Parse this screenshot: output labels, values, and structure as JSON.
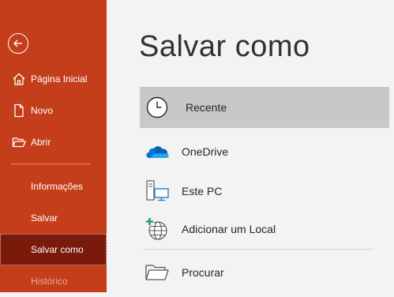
{
  "sidebar": {
    "back_icon": "back-arrow-icon",
    "items": [
      {
        "label": "Página Inicial",
        "icon": "home-icon"
      },
      {
        "label": "Novo",
        "icon": "new-document-icon"
      },
      {
        "label": "Abrir",
        "icon": "open-folder-icon"
      },
      {
        "label": "Informações"
      },
      {
        "label": "Salvar"
      },
      {
        "label": "Salvar como",
        "selected": true
      },
      {
        "label": "Histórico",
        "muted": true
      }
    ],
    "colors": {
      "background": "#c43e1c",
      "selected": "#7a1a0a"
    }
  },
  "main": {
    "title": "Salvar como",
    "locations": [
      {
        "label": "Recente",
        "icon": "clock-icon",
        "selected": true
      },
      {
        "label": "OneDrive",
        "icon": "onedrive-cloud-icon"
      },
      {
        "label": "Este PC",
        "icon": "computer-icon"
      },
      {
        "label": "Adicionar um Local",
        "icon": "add-place-globe-icon"
      },
      {
        "label": "Procurar",
        "icon": "browse-folder-icon"
      }
    ]
  }
}
